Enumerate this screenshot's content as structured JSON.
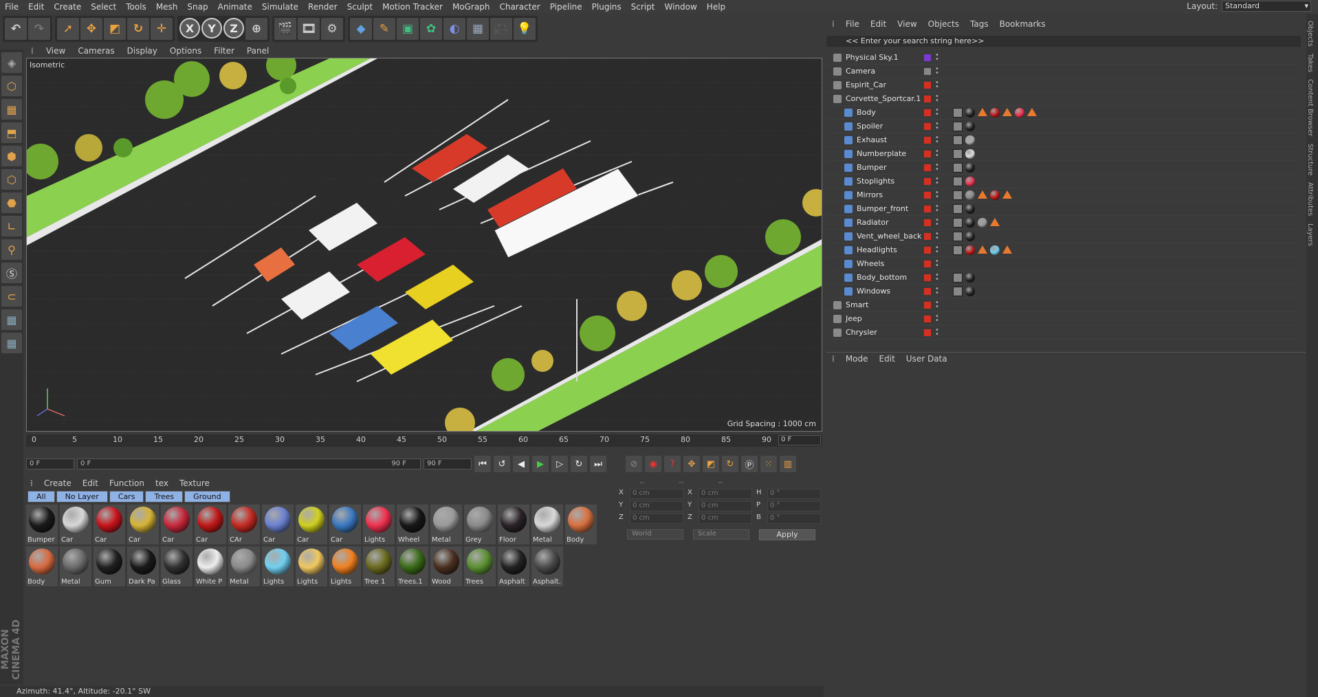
{
  "menu": [
    "File",
    "Edit",
    "Create",
    "Select",
    "Tools",
    "Mesh",
    "Snap",
    "Animate",
    "Simulate",
    "Render",
    "Sculpt",
    "Motion Tracker",
    "MoGraph",
    "Character",
    "Pipeline",
    "Plugins",
    "Script",
    "Window",
    "Help"
  ],
  "layout": {
    "label": "Layout:",
    "value": "Standard"
  },
  "viewport": {
    "menu": [
      "View",
      "Cameras",
      "Display",
      "Options",
      "Filter",
      "Panel"
    ],
    "label": "Isometric",
    "grid_spacing": "Grid Spacing : 1000 cm"
  },
  "timeline": {
    "ticks": [
      "0",
      "5",
      "10",
      "15",
      "20",
      "25",
      "30",
      "35",
      "40",
      "45",
      "50",
      "55",
      "60",
      "65",
      "70",
      "75",
      "80",
      "85",
      "90"
    ],
    "current_frame": "0 F",
    "start_field": "0 F",
    "range_left": "0 F",
    "range_right": "90 F",
    "end_field": "90 F"
  },
  "materials": {
    "menu": [
      "Create",
      "Edit",
      "Function",
      "tex",
      "Texture"
    ],
    "tabs": [
      "All",
      "No Layer",
      "Cars",
      "Trees",
      "Ground"
    ],
    "items": [
      {
        "label": "Bumper",
        "color": "#1a1a1a"
      },
      {
        "label": "Car",
        "color": "#d8d8d8"
      },
      {
        "label": "Car",
        "color": "#c8141c"
      },
      {
        "label": "Car",
        "color": "#d6b436"
      },
      {
        "label": "Car",
        "color": "#c8283c"
      },
      {
        "label": "Car",
        "color": "#c01818"
      },
      {
        "label": "CAr",
        "color": "#c42a22"
      },
      {
        "label": "Car",
        "color": "#6a80d0"
      },
      {
        "label": "Car",
        "color": "#d0d020"
      },
      {
        "label": "Car",
        "color": "#3a78c0"
      },
      {
        "label": "Lights",
        "color": "#f03050"
      },
      {
        "label": "Wheel",
        "color": "#181818"
      },
      {
        "label": "Metal",
        "color": "#9a9a9a"
      },
      {
        "label": "Grey",
        "color": "#8a8a8a"
      },
      {
        "label": "Floor",
        "color": "#2a2228"
      },
      {
        "label": "Metal",
        "color": "#d8d8d8"
      },
      {
        "label": "Body",
        "color": "#d87040"
      },
      {
        "label": "Body",
        "color": "#d86a40"
      },
      {
        "label": "Metal",
        "color": "#6a6a6a"
      },
      {
        "label": "Gum",
        "color": "#202020"
      },
      {
        "label": "Dark Pa",
        "color": "#1a1a1a"
      },
      {
        "label": "Glass",
        "color": "#303030"
      },
      {
        "label": "White P",
        "color": "#eeeeee"
      },
      {
        "label": "Metal",
        "color": "#8a8a8a"
      },
      {
        "label": "Lights",
        "color": "#70d0f0"
      },
      {
        "label": "Lights",
        "color": "#f0c860"
      },
      {
        "label": "Lights",
        "color": "#f08020"
      },
      {
        "label": "Tree 1",
        "color": "#6a6a20"
      },
      {
        "label": "Trees.1",
        "color": "#3a6a18"
      },
      {
        "label": "Wood",
        "color": "#4a3020"
      },
      {
        "label": "Trees",
        "color": "#5a9030"
      },
      {
        "label": "Asphalt",
        "color": "#222222"
      },
      {
        "label": "Asphalt.",
        "color": "#4a4a4a"
      }
    ]
  },
  "coords": {
    "headers": [
      "--",
      "--",
      "--"
    ],
    "rows": [
      {
        "a": "X",
        "v1": "0 cm",
        "b": "X",
        "v2": "0 cm",
        "c": "H",
        "v3": "0 °"
      },
      {
        "a": "Y",
        "v1": "0 cm",
        "b": "Y",
        "v2": "0 cm",
        "c": "P",
        "v3": "0 °"
      },
      {
        "a": "Z",
        "v1": "0 cm",
        "b": "Z",
        "v2": "0 cm",
        "c": "B",
        "v3": "0 °"
      }
    ],
    "world": "World",
    "scale": "Scale",
    "apply": "Apply"
  },
  "status": "Azimuth: 41.4°, Altitude: -20.1° SW",
  "brand": "MAXON CINEMA 4D",
  "object_manager": {
    "menu": [
      "File",
      "Edit",
      "View",
      "Objects",
      "Tags",
      "Bookmarks"
    ],
    "search_placeholder": "<< Enter your search string here>>",
    "objects": [
      {
        "name": "Physical Sky.1",
        "indent": 0,
        "tags": []
      },
      {
        "name": "Camera",
        "indent": 0,
        "tags": []
      },
      {
        "name": "Espirit_Car",
        "indent": 0,
        "tags": []
      },
      {
        "name": "Corvette_Sportcar.1",
        "indent": 0,
        "tags": []
      },
      {
        "name": "Body",
        "indent": 1,
        "tags": [
          "chk",
          "#222",
          "tri",
          "#c01818",
          "tri",
          "#f03050",
          "tri"
        ]
      },
      {
        "name": "Spoiler",
        "indent": 1,
        "tags": [
          "chk",
          "#222"
        ]
      },
      {
        "name": "Exhaust",
        "indent": 1,
        "tags": [
          "chk",
          "#aaa"
        ]
      },
      {
        "name": "Numberplate",
        "indent": 1,
        "tags": [
          "chk",
          "#ddd"
        ]
      },
      {
        "name": "Bumper",
        "indent": 1,
        "tags": [
          "chk",
          "#222"
        ]
      },
      {
        "name": "Stoplights",
        "indent": 1,
        "tags": [
          "chk",
          "#f03050"
        ]
      },
      {
        "name": "Mirrors",
        "indent": 1,
        "tags": [
          "chk",
          "#888",
          "tri",
          "#c01818",
          "tri"
        ]
      },
      {
        "name": "Bumper_front",
        "indent": 1,
        "tags": [
          "chk",
          "#222"
        ]
      },
      {
        "name": "Radiator",
        "indent": 1,
        "tags": [
          "chk",
          "#222",
          "#999",
          "tri"
        ]
      },
      {
        "name": "Vent_wheel_back",
        "indent": 1,
        "tags": [
          "chk",
          "#222"
        ]
      },
      {
        "name": "Headlights",
        "indent": 1,
        "tags": [
          "chk",
          "#c01818",
          "tri",
          "#70d0f0",
          "tri"
        ]
      },
      {
        "name": "Wheels",
        "indent": 1,
        "tags": []
      },
      {
        "name": "Body_bottom",
        "indent": 1,
        "tags": [
          "chk",
          "#222"
        ]
      },
      {
        "name": "Windows",
        "indent": 1,
        "tags": [
          "chk",
          "#222"
        ]
      },
      {
        "name": "Smart",
        "indent": 0,
        "tags": []
      },
      {
        "name": "Jeep",
        "indent": 0,
        "tags": []
      },
      {
        "name": "Chrysler",
        "indent": 0,
        "tags": []
      }
    ]
  },
  "attributes": {
    "menu": [
      "Mode",
      "Edit",
      "User Data"
    ]
  },
  "side_tabs": [
    "Objects",
    "Takes",
    "Content Browser",
    "Structure",
    "Attributes",
    "Layers"
  ]
}
